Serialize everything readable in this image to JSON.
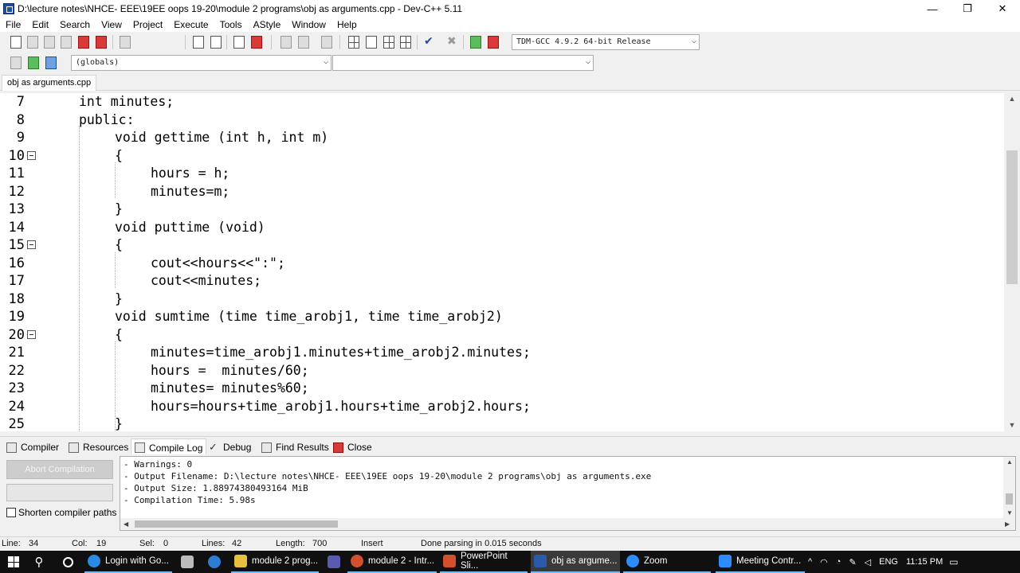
{
  "window": {
    "title": "D:\\lecture notes\\NHCE- EEE\\19EE oops 19-20\\module 2 programs\\obj as arguments.cpp - Dev-C++ 5.11",
    "minimize": "—",
    "restore": "❐",
    "close": "✕"
  },
  "menu": [
    "File",
    "Edit",
    "Search",
    "View",
    "Project",
    "Execute",
    "Tools",
    "AStyle",
    "Window",
    "Help"
  ],
  "toolbar": {
    "compiler_select": "TDM-GCC 4.9.2 64-bit Release",
    "scope_select": "(globals)",
    "member_select": ""
  },
  "file_tab": "obj as arguments.cpp",
  "editor": {
    "lines": [
      {
        "num": "7",
        "indent": 1,
        "text": "int minutes;",
        "fold": false
      },
      {
        "num": "8",
        "indent": 1,
        "text": "public:",
        "fold": false
      },
      {
        "num": "9",
        "indent": 2,
        "text": "void gettime (int h, int m)",
        "fold": false
      },
      {
        "num": "10",
        "indent": 2,
        "text": "{",
        "fold": true
      },
      {
        "num": "11",
        "indent": 3,
        "text": "hours = h;",
        "fold": false
      },
      {
        "num": "12",
        "indent": 3,
        "text": "minutes=m;",
        "fold": false
      },
      {
        "num": "13",
        "indent": 2,
        "text": "}",
        "fold": false
      },
      {
        "num": "14",
        "indent": 2,
        "text": "void puttime (void)",
        "fold": false
      },
      {
        "num": "15",
        "indent": 2,
        "text": "{",
        "fold": true
      },
      {
        "num": "16",
        "indent": 3,
        "text": "cout<<hours<<\":\";",
        "fold": false
      },
      {
        "num": "17",
        "indent": 3,
        "text": "cout<<minutes;",
        "fold": false
      },
      {
        "num": "18",
        "indent": 2,
        "text": "}",
        "fold": false
      },
      {
        "num": "19",
        "indent": 2,
        "text": "void sumtime (time time_arobj1, time time_arobj2)",
        "fold": false
      },
      {
        "num": "20",
        "indent": 2,
        "text": "{",
        "fold": true
      },
      {
        "num": "21",
        "indent": 3,
        "text": "minutes=time_arobj1.minutes+time_arobj2.minutes;",
        "fold": false
      },
      {
        "num": "22",
        "indent": 3,
        "text": "hours =  minutes/60;",
        "fold": false
      },
      {
        "num": "23",
        "indent": 3,
        "text": "minutes= minutes%60;",
        "fold": false
      },
      {
        "num": "24",
        "indent": 3,
        "text": "hours=hours+time_arobj1.hours+time_arobj2.hours;",
        "fold": false
      },
      {
        "num": "25",
        "indent": 2,
        "text": "}",
        "fold": false
      }
    ]
  },
  "bottom_tabs": [
    "Compiler",
    "Resources",
    "Compile Log",
    "Debug",
    "Find Results",
    "Close"
  ],
  "active_bottom_tab": "Compile Log",
  "abort_button": "Abort Compilation",
  "shorten_paths": "Shorten compiler paths",
  "compile_log": [
    "- Warnings: 0",
    "- Output Filename: D:\\lecture notes\\NHCE- EEE\\19EE oops 19-20\\module 2 programs\\obj as arguments.exe",
    "- Output Size: 1.88974380493164 MiB",
    "- Compilation Time: 5.98s"
  ],
  "status": {
    "line_label": "Line:",
    "line": "34",
    "col_label": "Col:",
    "col": "19",
    "sel_label": "Sel:",
    "sel": "0",
    "lines_label": "Lines:",
    "lines": "42",
    "length_label": "Length:",
    "length": "700",
    "mode": "Insert",
    "message": "Done parsing in 0.015 seconds"
  },
  "taskbar": {
    "items": [
      {
        "label": "Login with Go...",
        "icon": "chrome-icon",
        "color": "#2b8ae3"
      },
      {
        "label": "module 2 prog...",
        "icon": "folder-icon",
        "color": "#e8c040"
      },
      {
        "label": "module 2 - Intr...",
        "icon": "powerpoint-icon",
        "color": "#d2502e"
      },
      {
        "label": "PowerPoint Sli...",
        "icon": "powerpoint-slideshow-icon",
        "color": "#d2502e"
      },
      {
        "label": "obj as argume...",
        "icon": "devcpp-icon",
        "color": "#2a5aa8"
      },
      {
        "label": "Zoom",
        "icon": "zoom-icon",
        "color": "#2d8cff"
      },
      {
        "label": "Meeting Contr...",
        "icon": "meeting-controls-icon",
        "color": "#2d8cff"
      }
    ],
    "lang": "ENG",
    "time": "11:15 PM"
  },
  "colors": {
    "accent": "#76b9ed",
    "taskbar": "#101010",
    "editor_bg": "#ffffff"
  }
}
